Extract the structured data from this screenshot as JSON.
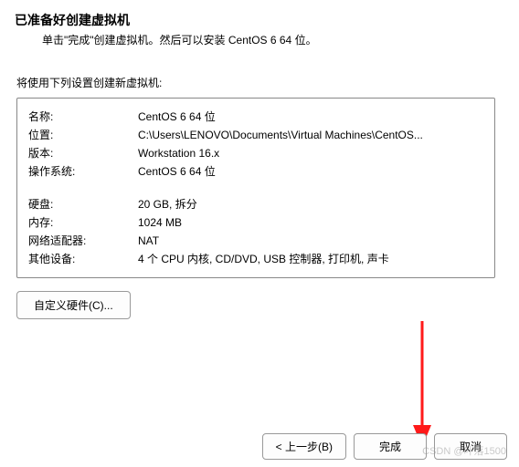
{
  "header": {
    "title": "已准备好创建虚拟机",
    "subtitle": "单击\"完成\"创建虚拟机。然后可以安装 CentOS 6 64 位。"
  },
  "section_label": "将使用下列设置创建新虚拟机:",
  "summary": {
    "rows1": [
      {
        "label": "名称:",
        "value": "CentOS 6 64 位"
      },
      {
        "label": "位置:",
        "value": "C:\\Users\\LENOVO\\Documents\\Virtual Machines\\CentOS..."
      },
      {
        "label": "版本:",
        "value": "Workstation 16.x"
      },
      {
        "label": "操作系统:",
        "value": "CentOS 6 64 位"
      }
    ],
    "rows2": [
      {
        "label": "硬盘:",
        "value": "20 GB, 拆分"
      },
      {
        "label": "内存:",
        "value": "1024 MB"
      },
      {
        "label": "网络适配器:",
        "value": "NAT"
      },
      {
        "label": "其他设备:",
        "value": "4 个 CPU 内核, CD/DVD, USB 控制器, 打印机, 声卡"
      }
    ]
  },
  "buttons": {
    "customize": "自定义硬件(C)...",
    "back": "< 上一步(B)",
    "finish": "完成",
    "cancel": "取消"
  },
  "watermark": "CSDN @叶落1500",
  "arrow_color": "#ff1a1a"
}
